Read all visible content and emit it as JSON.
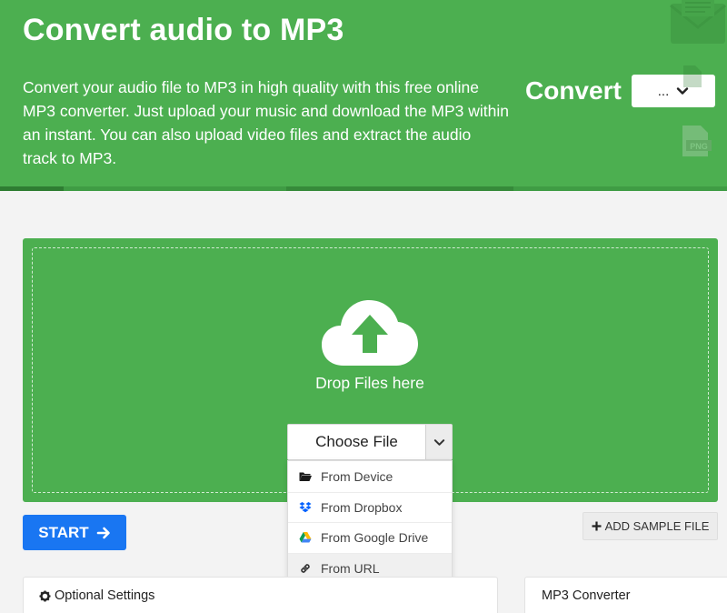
{
  "hero": {
    "title": "Convert audio to MP3",
    "description": "Convert your audio file to MP3 in high quality with this free online MP3 converter. Just upload your music and download the MP3 within an instant. You can also upload video files and extract the audio track to MP3.",
    "convert_label": "Convert",
    "convert_select_value": "...",
    "deco_png_text": "PNG"
  },
  "dropzone": {
    "drop_text": "Drop Files here",
    "choose_file_label": "Choose File",
    "menu": [
      {
        "label": "From Device",
        "icon": "folder-icon"
      },
      {
        "label": "From Dropbox",
        "icon": "dropbox-icon"
      },
      {
        "label": "From Google Drive",
        "icon": "google-drive-icon"
      },
      {
        "label": "From URL",
        "icon": "link-icon"
      }
    ]
  },
  "actions": {
    "start_label": "START",
    "add_sample_label": "ADD SAMPLE FILE"
  },
  "panels": {
    "settings_title": "Optional Settings",
    "converter_title": "MP3 Converter"
  },
  "colors": {
    "brand_green": "#4caf50",
    "start_blue": "#1976f2"
  }
}
